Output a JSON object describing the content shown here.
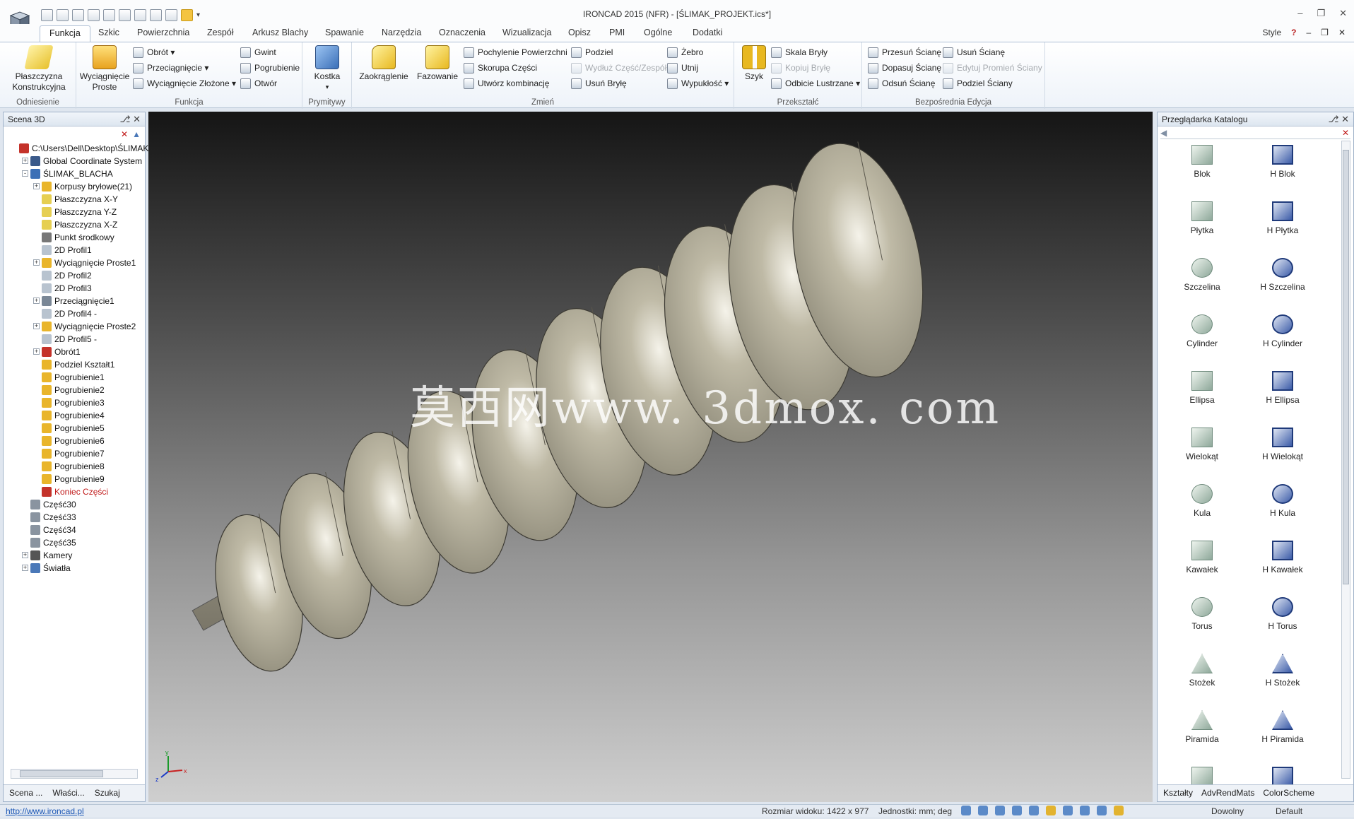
{
  "window": {
    "title": "IRONCAD 2015 (NFR) - [ŚLIMAK_PROJEKT.ics*]",
    "style_label": "Style",
    "help_icon": "question-icon"
  },
  "tabs": [
    "Funkcja",
    "Szkic",
    "Powierzchnia",
    "Zespół",
    "Arkusz Blachy",
    "Spawanie",
    "Narzędzia",
    "Oznaczenia",
    "Wizualizacja",
    "Opisz",
    "PMI",
    "Ogólne",
    "Dodatki"
  ],
  "ribbon": {
    "odniesienie": {
      "label": "Odniesienie",
      "plaszczyzna": "Płaszczyzna Konstrukcyjna"
    },
    "funkcja": {
      "label": "Funkcja",
      "wyciagniecie": "Wyciągnięcie Proste",
      "obrot": "Obrót",
      "przeciagniecie": "Przeciągnięcie",
      "wyciagniecie_zlozone": "Wyciągnięcie Złożone",
      "gwint": "Gwint",
      "pogrubienie": "Pogrubienie",
      "otwor": "Otwór"
    },
    "prymitywy": {
      "label": "Prymitywy",
      "kostka": "Kostka"
    },
    "zmien": {
      "label": "Zmień",
      "zaokraglenie": "Zaokrąglenie",
      "fazowanie": "Fazowanie",
      "pochylenie": "Pochylenie Powierzchni",
      "skorupa": "Skorupa Części",
      "utworz": "Utwórz kombinację",
      "podziel": "Podziel",
      "wydluz": "Wydłuż Część/Zespół",
      "usun_bryle": "Usuń Bryłę",
      "zebro": "Żebro",
      "utnij": "Utnij",
      "wypuklosc": "Wypukłość"
    },
    "przeksztalc": {
      "label": "Przekształć",
      "szyk": "Szyk",
      "skala": "Skala Bryły",
      "kopiuj": "Kopiuj Bryłę",
      "odbicie": "Odbicie Lustrzane"
    },
    "edycja": {
      "label": "Bezpośrednia Edycja",
      "przesun": "Przesuń Ścianę",
      "dopasuj": "Dopasuj Ścianę",
      "odsun": "Odsuń Ścianę",
      "usun_sciane": "Usuń Ścianę",
      "edytuj_promien": "Edytuj Promień Ściany",
      "podziel_sciany": "Podziel Ściany"
    }
  },
  "scene": {
    "title": "Scena 3D",
    "tree": [
      {
        "label": "C:\\Users\\Dell\\Desktop\\ŚLIMAK_",
        "level": 0,
        "exp": "",
        "icon": "#c4322a"
      },
      {
        "label": "Global Coordinate System",
        "level": 1,
        "exp": "+",
        "icon": "#3a5a8a"
      },
      {
        "label": "ŚLIMAK_BLACHA",
        "level": 1,
        "exp": "-",
        "icon": "#3b6fb6"
      },
      {
        "label": "Korpusy bryłowe(21)",
        "level": 2,
        "exp": "+",
        "icon": "#e9b52b"
      },
      {
        "label": "Płaszczyzna X-Y",
        "level": 2,
        "exp": "",
        "icon": "#e6cf52"
      },
      {
        "label": "Płaszczyzna Y-Z",
        "level": 2,
        "exp": "",
        "icon": "#e6cf52"
      },
      {
        "label": "Płaszczyzna X-Z",
        "level": 2,
        "exp": "",
        "icon": "#e6cf52"
      },
      {
        "label": "Punkt środkowy",
        "level": 2,
        "exp": "",
        "icon": "#777777"
      },
      {
        "label": "2D Profil1",
        "level": 2,
        "exp": "",
        "icon": "#b8c3cf"
      },
      {
        "label": "Wyciągnięcie Proste1",
        "level": 2,
        "exp": "+",
        "icon": "#e9b52b"
      },
      {
        "label": "2D Profil2",
        "level": 2,
        "exp": "",
        "icon": "#b8c3cf"
      },
      {
        "label": "2D Profil3",
        "level": 2,
        "exp": "",
        "icon": "#b8c3cf"
      },
      {
        "label": "Przeciągnięcie1",
        "level": 2,
        "exp": "+",
        "icon": "#7a8796"
      },
      {
        "label": "2D Profil4 -",
        "level": 2,
        "exp": "",
        "icon": "#b8c3cf"
      },
      {
        "label": "Wyciągnięcie Proste2",
        "level": 2,
        "exp": "+",
        "icon": "#e9b52b"
      },
      {
        "label": "2D Profil5 -",
        "level": 2,
        "exp": "",
        "icon": "#b8c3cf"
      },
      {
        "label": "Obrót1",
        "level": 2,
        "exp": "+",
        "icon": "#c4322a"
      },
      {
        "label": "Podziel Kształt1",
        "level": 2,
        "exp": "",
        "icon": "#e9b52b"
      },
      {
        "label": "Pogrubienie1",
        "level": 2,
        "exp": "",
        "icon": "#e9b52b"
      },
      {
        "label": "Pogrubienie2",
        "level": 2,
        "exp": "",
        "icon": "#e9b52b"
      },
      {
        "label": "Pogrubienie3",
        "level": 2,
        "exp": "",
        "icon": "#e9b52b"
      },
      {
        "label": "Pogrubienie4",
        "level": 2,
        "exp": "",
        "icon": "#e9b52b"
      },
      {
        "label": "Pogrubienie5",
        "level": 2,
        "exp": "",
        "icon": "#e9b52b"
      },
      {
        "label": "Pogrubienie6",
        "level": 2,
        "exp": "",
        "icon": "#e9b52b"
      },
      {
        "label": "Pogrubienie7",
        "level": 2,
        "exp": "",
        "icon": "#e9b52b"
      },
      {
        "label": "Pogrubienie8",
        "level": 2,
        "exp": "",
        "icon": "#e9b52b"
      },
      {
        "label": "Pogrubienie9",
        "level": 2,
        "exp": "",
        "icon": "#e9b52b"
      },
      {
        "label": "Koniec Części",
        "level": 2,
        "exp": "",
        "icon": "#c4322a",
        "red": true
      },
      {
        "label": "Część30",
        "level": 1,
        "exp": "",
        "icon": "#8a94a0"
      },
      {
        "label": "Część33",
        "level": 1,
        "exp": "",
        "icon": "#8a94a0"
      },
      {
        "label": "Część34",
        "level": 1,
        "exp": "",
        "icon": "#8a94a0"
      },
      {
        "label": "Część35",
        "level": 1,
        "exp": "",
        "icon": "#8a94a0"
      },
      {
        "label": "Kamery",
        "level": 1,
        "exp": "+",
        "icon": "#555555"
      },
      {
        "label": "Światła",
        "level": 1,
        "exp": "+",
        "icon": "#4a78b8"
      }
    ],
    "tabs": [
      "Scena ...",
      "Właści...",
      "Szukaj"
    ]
  },
  "viewport": {
    "watermark": "莫西网www. 3dmox. com",
    "axis_x": "x",
    "axis_y": "y",
    "axis_z": "z"
  },
  "catalog": {
    "title": "Przeglądarka Katalogu",
    "items": [
      "Blok",
      "H Blok",
      "Płytka",
      "H Płytka",
      "Szczelina",
      "H Szczelina",
      "Cylinder",
      "H Cylinder",
      "Ellipsa",
      "H Ellipsa",
      "Wielokąt",
      "H Wielokąt",
      "Kula",
      "H Kula",
      "Kawałek",
      "H Kawałek",
      "Torus",
      "H Torus",
      "Stożek",
      "H Stożek",
      "Piramida",
      "H Piramida",
      "",
      ""
    ],
    "tabs": [
      "Kształty",
      "AdvRendMats",
      "ColorScheme"
    ]
  },
  "status": {
    "url": "http://www.ironcad.pl",
    "size": "Rozmiar widoku: 1422 x 977",
    "units": "Jednostki: mm; deg",
    "mode": "Dowolny",
    "scheme": "Default"
  }
}
